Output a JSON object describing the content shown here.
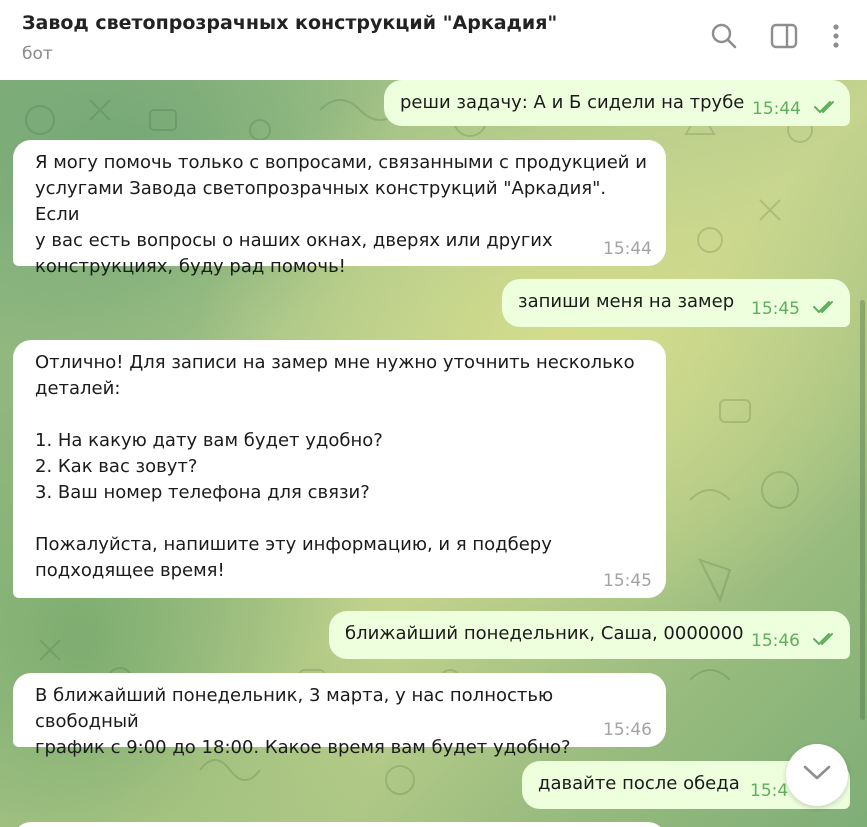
{
  "header": {
    "title": "Завод светопрозрачных конструкций \"Аркадия\"",
    "subtitle": "бот",
    "icons": [
      "search-icon",
      "sidebar-toggle-icon",
      "more-vertical-icon"
    ]
  },
  "messages": [
    {
      "direction": "outgoing",
      "text": "реши задачу: А и Б сидели на трубе",
      "time": "15:44",
      "status": "read"
    },
    {
      "direction": "incoming",
      "text": "Я могу помочь только с вопросами, связанными с продукцией и\nуслугами Завода светопрозрачных конструкций \"Аркадия\". Если\nу вас есть вопросы о наших окнах, дверях или других\nконструкциях, буду рад помочь!",
      "time": "15:44"
    },
    {
      "direction": "outgoing",
      "text": "запиши меня на замер",
      "time": "15:45",
      "status": "read"
    },
    {
      "direction": "incoming",
      "text": "Отлично! Для записи на замер мне нужно уточнить несколько\nдеталей:\n\n1. На какую дату вам будет удобно?\n2. Как вас зовут?\n3. Ваш номер телефона для связи?\n\nПожалуйста, напишите эту информацию, и я подберу\nподходящее время!",
      "time": "15:45"
    },
    {
      "direction": "outgoing",
      "text": "ближайший понедельник, Саша, 0000000",
      "time": "15:46",
      "status": "read"
    },
    {
      "direction": "incoming",
      "text": "В ближайший понедельник, 3 марта, у нас полностью свободный\nграфик с 9:00 до 18:00. Какое время вам будет удобно?",
      "time": "15:46"
    },
    {
      "direction": "outgoing",
      "text": "давайте после обеда",
      "time": "15:4",
      "status": "read"
    }
  ],
  "colors": {
    "incoming_bubble": "#ffffff",
    "outgoing_bubble": "#eeffde",
    "outgoing_time": "#5eae5c",
    "incoming_time": "#a3a3a3",
    "header_icon": "#8e8e8e"
  },
  "scroll_down_icon": "chevron-down-icon"
}
